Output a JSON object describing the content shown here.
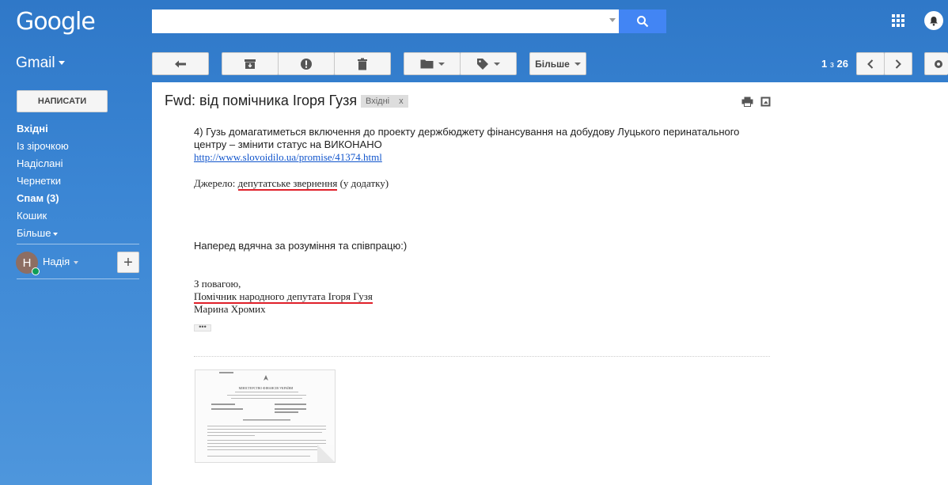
{
  "header": {
    "logo": "Google",
    "search": {
      "value": "",
      "placeholder": ""
    },
    "apps_icon": "apps-grid-icon",
    "notifications_icon": "bell-icon"
  },
  "toolbar": {
    "app_label": "Gmail",
    "back_icon": "arrow-left-icon",
    "archive_icon": "archive-icon",
    "spam_icon": "report-spam-icon",
    "delete_icon": "trash-icon",
    "move_icon": "folder-icon",
    "labels_icon": "tag-icon",
    "more_label": "Більше",
    "page_current": "1",
    "page_of": "з",
    "page_total": "26",
    "settings_icon": "gear-icon"
  },
  "sidebar": {
    "compose_label": "НАПИСАТИ",
    "items": [
      {
        "label": "Вхідні",
        "bold": true
      },
      {
        "label": "Із зірочкою",
        "bold": false
      },
      {
        "label": "Надіслані",
        "bold": false
      },
      {
        "label": "Чернетки",
        "bold": false
      },
      {
        "label": "Спам (3)",
        "bold": true
      },
      {
        "label": "Кошик",
        "bold": false
      },
      {
        "label": "Більше",
        "bold": false
      }
    ],
    "user": {
      "initial": "Н",
      "name": "Надія"
    },
    "add_label": "+"
  },
  "message": {
    "subject": "Fwd: від помічника Ігоря Гузя",
    "label_chip": "Вхідні",
    "label_chip_close": "x",
    "line1": "4) Гузь домагатиметься включення до проекту держбюджету фінансування на добудову Луцького перинатального",
    "line2": "центру – змінити статус на ВИКОНАНО",
    "link": "http://www.slovoidilo.ua/promise/41374.html",
    "source_prefix": "Джерело: ",
    "source_link": "депутатське звернення",
    "source_suffix": " (у додатку)",
    "thanks": "Наперед вдячна за розуміння та співпрацю:)",
    "regards": "З повагою,",
    "signature_title": "Помічник народного депутата Ігоря Гузя",
    "signature_name": "Марина Хромих",
    "ellipsis": "•••",
    "attachment_header": "МІНІСТЕРСТВО ФІНАНСІВ УКРАЇНИ"
  }
}
